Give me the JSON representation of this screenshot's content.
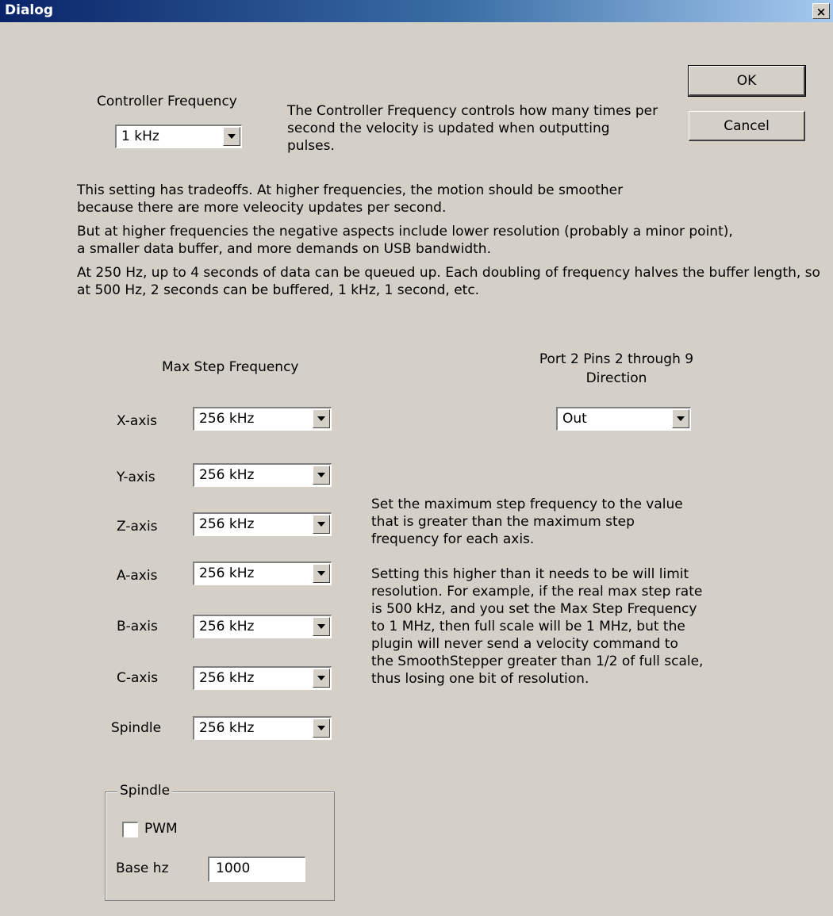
{
  "window": {
    "title": "Dialog",
    "close_label": "×"
  },
  "buttons": {
    "ok": "OK",
    "cancel": "Cancel"
  },
  "controller": {
    "label": "Controller Frequency",
    "value": "1 kHz",
    "description": "The Controller Frequency controls how many times per second the velocity is updated when outputting pulses."
  },
  "paragraphs": [
    "This setting has tradeoffs.  At higher frequencies, the motion should be smoother because there are more veleocity updates per second.",
    "But at higher frequencies the negative aspects include lower resolution (probably a minor point), a smaller data buffer, and more demands on USB bandwidth.",
    "At 250 Hz, up to 4 seconds of data can be queued up.  Each doubling of frequency halves the buffer length, so at 500 Hz, 2 seconds can be buffered, 1 kHz, 1 second, etc."
  ],
  "max_step": {
    "label": "Max Step Frequency",
    "axes": [
      {
        "name": "X-axis",
        "value": "256 kHz"
      },
      {
        "name": "Y-axis",
        "value": "256 kHz"
      },
      {
        "name": "Z-axis",
        "value": "256 kHz"
      },
      {
        "name": "A-axis",
        "value": "256 kHz"
      },
      {
        "name": "B-axis",
        "value": "256 kHz"
      },
      {
        "name": "C-axis",
        "value": "256 kHz"
      },
      {
        "name": "Spindle",
        "value": "256 kHz"
      }
    ]
  },
  "port": {
    "label_line1": "Port 2 Pins 2 through 9",
    "label_line2": "Direction",
    "value": "Out"
  },
  "info": [
    "Set the maximum step frequency to the value that is greater than the maximum step frequency for each axis.",
    "Setting this higher than it needs to be will limit resolution.  For example, if the real max step rate is 500 kHz, and you set the Max Step Frequency to 1 MHz, then full scale will be 1 MHz, but the plugin will never send a velocity command to the SmoothStepper greater than 1/2 of full scale, thus losing one bit of resolution."
  ],
  "spindle": {
    "group_label": "Spindle",
    "pwm_label": "PWM",
    "pwm_checked": false,
    "base_label": "Base hz",
    "base_value": "1000"
  }
}
